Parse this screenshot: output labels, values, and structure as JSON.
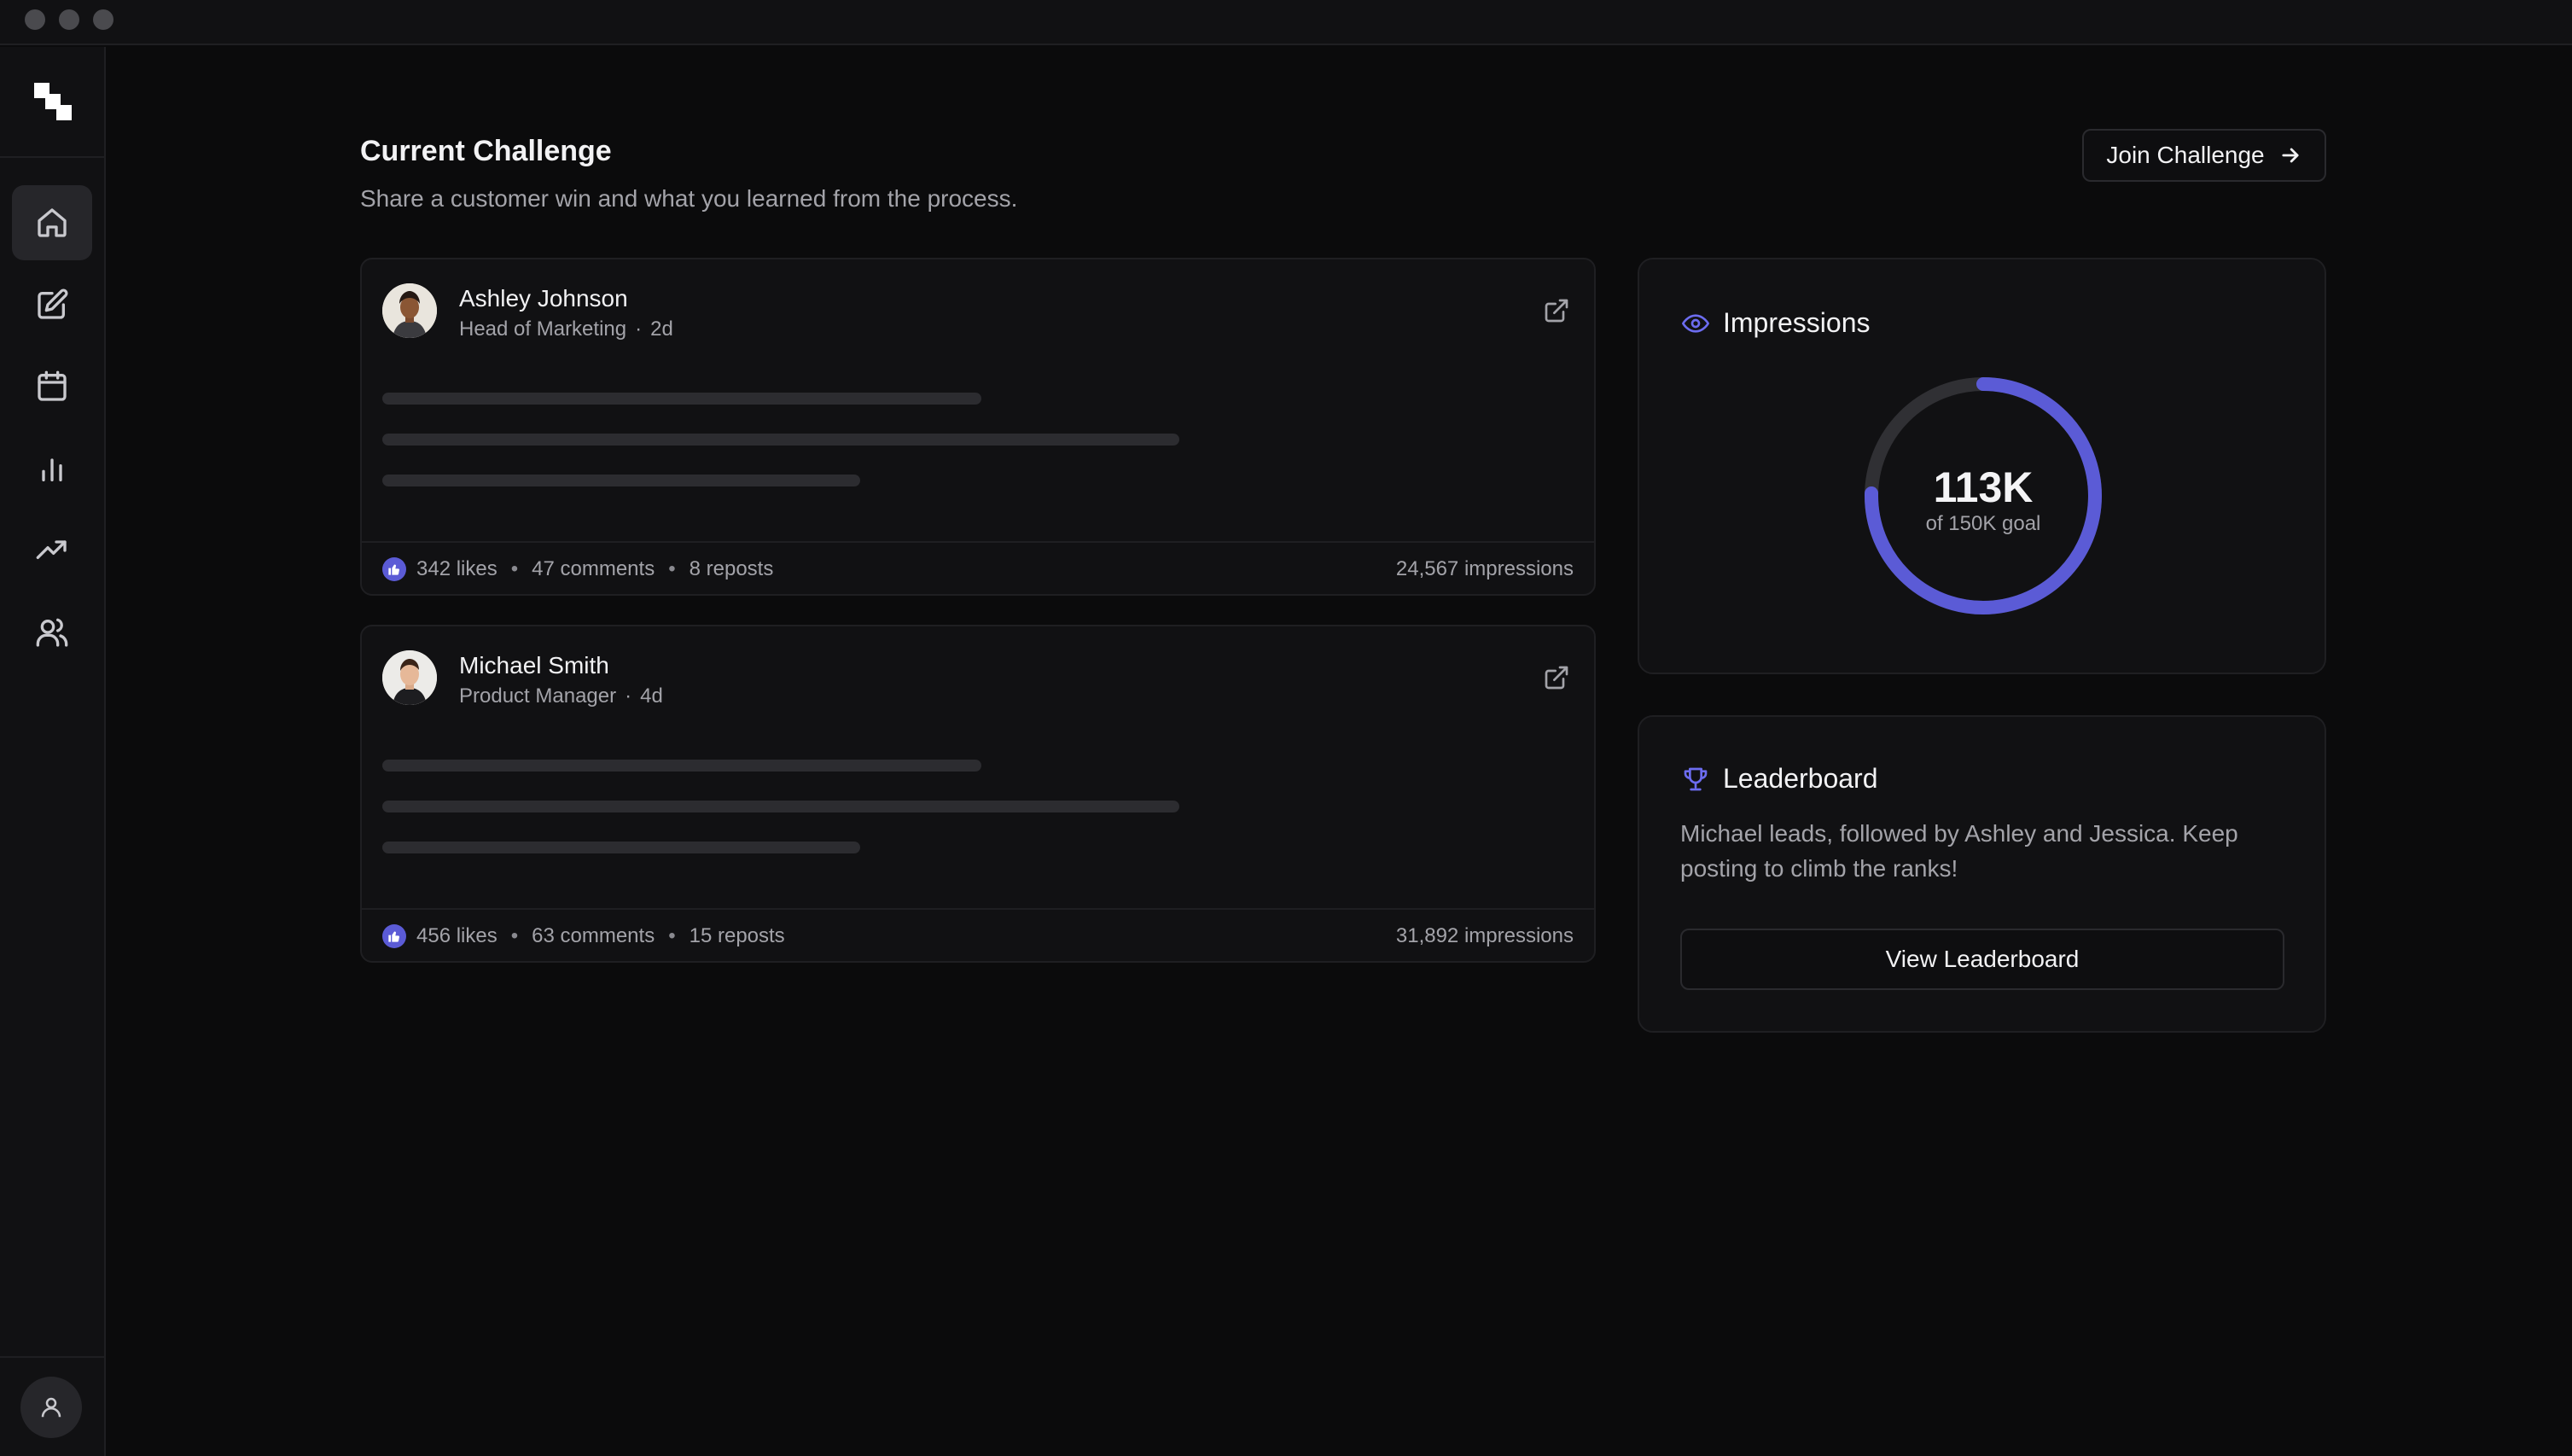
{
  "header": {
    "title": "Current Challenge",
    "subtitle": "Share a customer win and what you learned from the process.",
    "join_label": "Join Challenge"
  },
  "sidebar": {
    "items": [
      {
        "icon": "home-icon",
        "active": true
      },
      {
        "icon": "edit-icon",
        "active": false
      },
      {
        "icon": "calendar-icon",
        "active": false
      },
      {
        "icon": "bar-chart-icon",
        "active": false
      },
      {
        "icon": "trending-up-icon",
        "active": false
      },
      {
        "icon": "users-icon",
        "active": false
      }
    ],
    "user_icon": "user-icon"
  },
  "posts": [
    {
      "name": "Ashley Johnson",
      "role": "Head of Marketing",
      "age": "2d",
      "likes": "342 likes",
      "comments": "47 comments",
      "reposts": "8 reposts",
      "impressions": "24,567 impressions"
    },
    {
      "name": "Michael Smith",
      "role": "Product Manager",
      "age": "4d",
      "likes": "456 likes",
      "comments": "63 comments",
      "reposts": "15 reposts",
      "impressions": "31,892 impressions"
    }
  ],
  "impressions": {
    "title": "Impressions",
    "value_label": "113K",
    "goal_label": "of 150K goal",
    "value": 113000,
    "goal": 150000
  },
  "leaderboard": {
    "title": "Leaderboard",
    "text": "Michael leads, followed by Ashley and Jessica. Keep posting to climb the ranks!",
    "button_label": "View Leaderboard"
  },
  "colors": {
    "accent": "#5b5bd6",
    "background": "#0b0b0c",
    "card": "#111113"
  }
}
